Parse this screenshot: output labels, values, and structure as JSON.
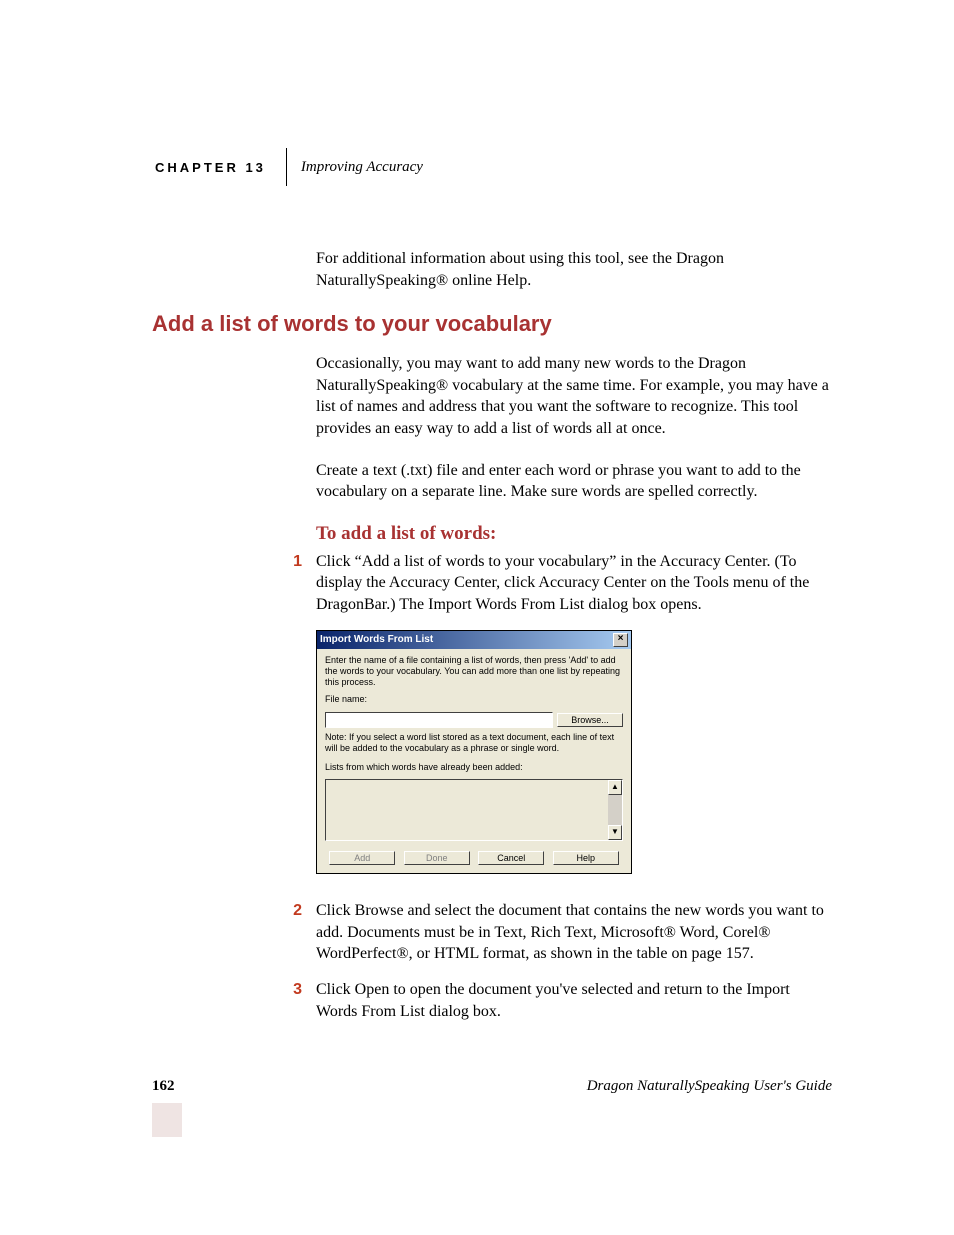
{
  "header": {
    "chapter_label": "CHAPTER 13",
    "chapter_title": "Improving Accuracy"
  },
  "intro_para": "For additional information about using this tool, see the Dragon NaturallySpeaking® online Help.",
  "section_heading": "Add a list of words to your vocabulary",
  "para1": "Occasionally, you may want to add many new words to the Dragon NaturallySpeaking® vocabulary at the same time. For example, you may have a list of names and address that you want the software to recognize. This tool provides an easy way to add a list of words all at once.",
  "para2": "Create a text (.txt) file and enter each word or phrase you want to add to the vocabulary on a separate line. Make sure words are spelled correctly.",
  "sub_heading": "To add a list of words:",
  "steps": [
    {
      "num": "1",
      "text": "Click “Add a list of words to your vocabulary” in the Accuracy Center. (To display the Accuracy Center, click Accuracy Center on the Tools menu of the DragonBar.) The Import Words From List dialog box opens."
    },
    {
      "num": "2",
      "text": "Click Browse and select the document that contains the new words you want to add. Documents must be in Text, Rich Text, Microsoft® Word, Corel® WordPerfect®, or HTML format, as shown in the table on page 157."
    },
    {
      "num": "3",
      "text": "Click Open to open the document you've selected and return to the Import Words From List dialog box."
    }
  ],
  "dialog": {
    "title": "Import Words From List",
    "instruction": "Enter the name of a file containing a list of words, then press 'Add' to add the words to your vocabulary. You can add more than one list by repeating this process.",
    "file_label": "File name:",
    "browse": "Browse...",
    "note": "Note: If you select a word list stored as a text document, each line of text will be added to the vocabulary as a phrase or single word.",
    "lists_label": "Lists from which words have already been added:",
    "buttons": {
      "add": "Add",
      "done": "Done",
      "cancel": "Cancel",
      "help": "Help"
    }
  },
  "footer": {
    "page": "162",
    "guide": "Dragon NaturallySpeaking User's Guide"
  }
}
